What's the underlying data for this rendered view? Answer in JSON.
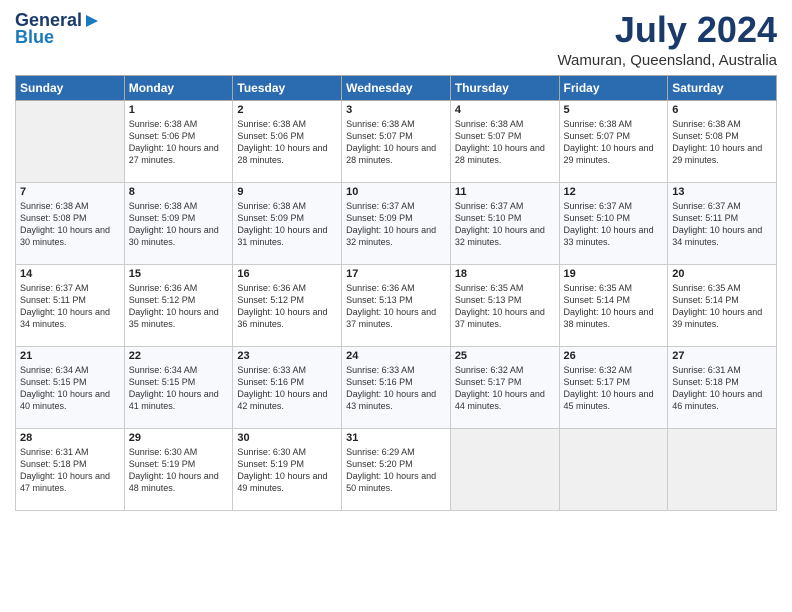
{
  "header": {
    "logo_line1": "General",
    "logo_line2": "Blue",
    "title": "July 2024",
    "subtitle": "Wamuran, Queensland, Australia"
  },
  "days_of_week": [
    "Sunday",
    "Monday",
    "Tuesday",
    "Wednesday",
    "Thursday",
    "Friday",
    "Saturday"
  ],
  "weeks": [
    [
      {
        "day": "",
        "sunrise": "",
        "sunset": "",
        "daylight": ""
      },
      {
        "day": "1",
        "sunrise": "Sunrise: 6:38 AM",
        "sunset": "Sunset: 5:06 PM",
        "daylight": "Daylight: 10 hours and 27 minutes."
      },
      {
        "day": "2",
        "sunrise": "Sunrise: 6:38 AM",
        "sunset": "Sunset: 5:06 PM",
        "daylight": "Daylight: 10 hours and 28 minutes."
      },
      {
        "day": "3",
        "sunrise": "Sunrise: 6:38 AM",
        "sunset": "Sunset: 5:07 PM",
        "daylight": "Daylight: 10 hours and 28 minutes."
      },
      {
        "day": "4",
        "sunrise": "Sunrise: 6:38 AM",
        "sunset": "Sunset: 5:07 PM",
        "daylight": "Daylight: 10 hours and 28 minutes."
      },
      {
        "day": "5",
        "sunrise": "Sunrise: 6:38 AM",
        "sunset": "Sunset: 5:07 PM",
        "daylight": "Daylight: 10 hours and 29 minutes."
      },
      {
        "day": "6",
        "sunrise": "Sunrise: 6:38 AM",
        "sunset": "Sunset: 5:08 PM",
        "daylight": "Daylight: 10 hours and 29 minutes."
      }
    ],
    [
      {
        "day": "7",
        "sunrise": "Sunrise: 6:38 AM",
        "sunset": "Sunset: 5:08 PM",
        "daylight": "Daylight: 10 hours and 30 minutes."
      },
      {
        "day": "8",
        "sunrise": "Sunrise: 6:38 AM",
        "sunset": "Sunset: 5:09 PM",
        "daylight": "Daylight: 10 hours and 30 minutes."
      },
      {
        "day": "9",
        "sunrise": "Sunrise: 6:38 AM",
        "sunset": "Sunset: 5:09 PM",
        "daylight": "Daylight: 10 hours and 31 minutes."
      },
      {
        "day": "10",
        "sunrise": "Sunrise: 6:37 AM",
        "sunset": "Sunset: 5:09 PM",
        "daylight": "Daylight: 10 hours and 32 minutes."
      },
      {
        "day": "11",
        "sunrise": "Sunrise: 6:37 AM",
        "sunset": "Sunset: 5:10 PM",
        "daylight": "Daylight: 10 hours and 32 minutes."
      },
      {
        "day": "12",
        "sunrise": "Sunrise: 6:37 AM",
        "sunset": "Sunset: 5:10 PM",
        "daylight": "Daylight: 10 hours and 33 minutes."
      },
      {
        "day": "13",
        "sunrise": "Sunrise: 6:37 AM",
        "sunset": "Sunset: 5:11 PM",
        "daylight": "Daylight: 10 hours and 34 minutes."
      }
    ],
    [
      {
        "day": "14",
        "sunrise": "Sunrise: 6:37 AM",
        "sunset": "Sunset: 5:11 PM",
        "daylight": "Daylight: 10 hours and 34 minutes."
      },
      {
        "day": "15",
        "sunrise": "Sunrise: 6:36 AM",
        "sunset": "Sunset: 5:12 PM",
        "daylight": "Daylight: 10 hours and 35 minutes."
      },
      {
        "day": "16",
        "sunrise": "Sunrise: 6:36 AM",
        "sunset": "Sunset: 5:12 PM",
        "daylight": "Daylight: 10 hours and 36 minutes."
      },
      {
        "day": "17",
        "sunrise": "Sunrise: 6:36 AM",
        "sunset": "Sunset: 5:13 PM",
        "daylight": "Daylight: 10 hours and 37 minutes."
      },
      {
        "day": "18",
        "sunrise": "Sunrise: 6:35 AM",
        "sunset": "Sunset: 5:13 PM",
        "daylight": "Daylight: 10 hours and 37 minutes."
      },
      {
        "day": "19",
        "sunrise": "Sunrise: 6:35 AM",
        "sunset": "Sunset: 5:14 PM",
        "daylight": "Daylight: 10 hours and 38 minutes."
      },
      {
        "day": "20",
        "sunrise": "Sunrise: 6:35 AM",
        "sunset": "Sunset: 5:14 PM",
        "daylight": "Daylight: 10 hours and 39 minutes."
      }
    ],
    [
      {
        "day": "21",
        "sunrise": "Sunrise: 6:34 AM",
        "sunset": "Sunset: 5:15 PM",
        "daylight": "Daylight: 10 hours and 40 minutes."
      },
      {
        "day": "22",
        "sunrise": "Sunrise: 6:34 AM",
        "sunset": "Sunset: 5:15 PM",
        "daylight": "Daylight: 10 hours and 41 minutes."
      },
      {
        "day": "23",
        "sunrise": "Sunrise: 6:33 AM",
        "sunset": "Sunset: 5:16 PM",
        "daylight": "Daylight: 10 hours and 42 minutes."
      },
      {
        "day": "24",
        "sunrise": "Sunrise: 6:33 AM",
        "sunset": "Sunset: 5:16 PM",
        "daylight": "Daylight: 10 hours and 43 minutes."
      },
      {
        "day": "25",
        "sunrise": "Sunrise: 6:32 AM",
        "sunset": "Sunset: 5:17 PM",
        "daylight": "Daylight: 10 hours and 44 minutes."
      },
      {
        "day": "26",
        "sunrise": "Sunrise: 6:32 AM",
        "sunset": "Sunset: 5:17 PM",
        "daylight": "Daylight: 10 hours and 45 minutes."
      },
      {
        "day": "27",
        "sunrise": "Sunrise: 6:31 AM",
        "sunset": "Sunset: 5:18 PM",
        "daylight": "Daylight: 10 hours and 46 minutes."
      }
    ],
    [
      {
        "day": "28",
        "sunrise": "Sunrise: 6:31 AM",
        "sunset": "Sunset: 5:18 PM",
        "daylight": "Daylight: 10 hours and 47 minutes."
      },
      {
        "day": "29",
        "sunrise": "Sunrise: 6:30 AM",
        "sunset": "Sunset: 5:19 PM",
        "daylight": "Daylight: 10 hours and 48 minutes."
      },
      {
        "day": "30",
        "sunrise": "Sunrise: 6:30 AM",
        "sunset": "Sunset: 5:19 PM",
        "daylight": "Daylight: 10 hours and 49 minutes."
      },
      {
        "day": "31",
        "sunrise": "Sunrise: 6:29 AM",
        "sunset": "Sunset: 5:20 PM",
        "daylight": "Daylight: 10 hours and 50 minutes."
      },
      {
        "day": "",
        "sunrise": "",
        "sunset": "",
        "daylight": ""
      },
      {
        "day": "",
        "sunrise": "",
        "sunset": "",
        "daylight": ""
      },
      {
        "day": "",
        "sunrise": "",
        "sunset": "",
        "daylight": ""
      }
    ]
  ]
}
